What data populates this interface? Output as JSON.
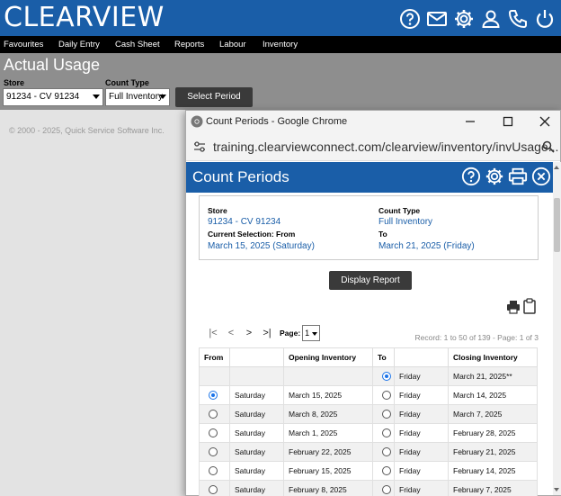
{
  "app": {
    "logo": "CLEARVIEW",
    "header_icons": [
      "help-icon",
      "mail-icon",
      "gear-icon",
      "user-icon",
      "phone-icon",
      "power-icon"
    ],
    "nav": [
      "Favourites",
      "Daily Entry",
      "Cash Sheet",
      "Reports",
      "Labour",
      "Inventory"
    ],
    "page_title": "Actual Usage",
    "store_label": "Store",
    "store_value": "91234 - CV 91234",
    "count_type_label": "Count Type",
    "count_type_value": "Full Inventory",
    "select_period_button": "Select Period",
    "copyright": "© 2000 - 2025, Quick Service Software Inc.",
    "brand_color": "#1a5ea8"
  },
  "popup": {
    "window_title": "Count Periods - Google Chrome",
    "url": "training.clearviewconnect.com/clearview/inventory/invUsage...",
    "header_title": "Count Periods",
    "header_icons": [
      "help-icon",
      "gear-icon",
      "print-icon",
      "close-icon"
    ],
    "info": {
      "store_label": "Store",
      "store_value": "91234 - CV 91234",
      "count_type_label": "Count Type",
      "count_type_value": "Full Inventory",
      "from_label": "Current Selection: From",
      "from_value": "March 15, 2025 (Saturday)",
      "to_label": "To",
      "to_value": "March 21, 2025 (Friday)"
    },
    "display_report_button": "Display Report",
    "pager": {
      "first": "|<",
      "prev": "<",
      "next": ">",
      "last": ">|",
      "page_label": "Page:",
      "page_value": "1",
      "record_text": "Record: 1 to 50 of 139 - Page: 1 of 3"
    },
    "table": {
      "headers": [
        "From",
        "",
        "Opening Inventory",
        "To",
        "",
        "Closing Inventory"
      ],
      "rows": [
        {
          "from_radio": "none",
          "from_day": "",
          "opening": "",
          "to_radio": "on",
          "to_day": "Friday",
          "closing": "March 21, 2025**"
        },
        {
          "from_radio": "on",
          "from_day": "Saturday",
          "opening": "March 15, 2025",
          "to_radio": "off",
          "to_day": "Friday",
          "closing": "March 14, 2025"
        },
        {
          "from_radio": "off",
          "from_day": "Saturday",
          "opening": "March 8, 2025",
          "to_radio": "off",
          "to_day": "Friday",
          "closing": "March 7, 2025"
        },
        {
          "from_radio": "off",
          "from_day": "Saturday",
          "opening": "March 1, 2025",
          "to_radio": "off",
          "to_day": "Friday",
          "closing": "February 28, 2025"
        },
        {
          "from_radio": "off",
          "from_day": "Saturday",
          "opening": "February 22, 2025",
          "to_radio": "off",
          "to_day": "Friday",
          "closing": "February 21, 2025"
        },
        {
          "from_radio": "off",
          "from_day": "Saturday",
          "opening": "February 15, 2025",
          "to_radio": "off",
          "to_day": "Friday",
          "closing": "February 14, 2025"
        },
        {
          "from_radio": "off",
          "from_day": "Saturday",
          "opening": "February 8, 2025",
          "to_radio": "off",
          "to_day": "Friday",
          "closing": "February 7, 2025"
        }
      ]
    }
  }
}
